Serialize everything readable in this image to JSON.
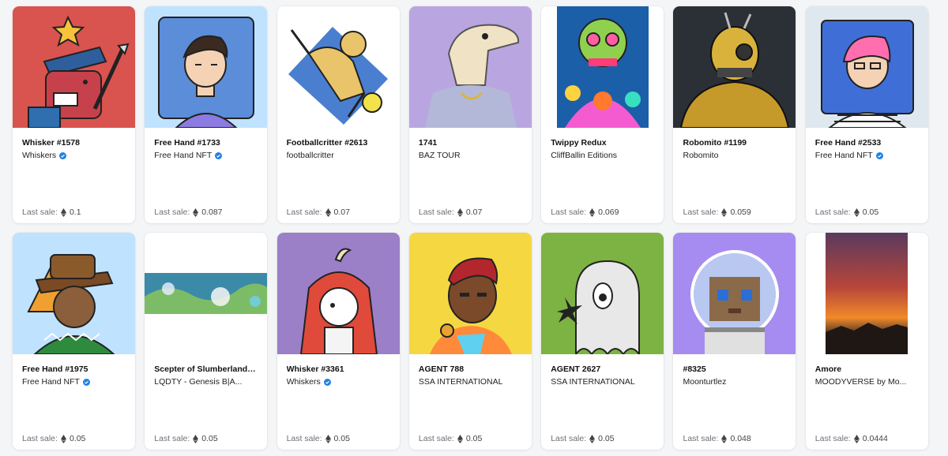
{
  "sale_label": "Last sale:",
  "cards": [
    {
      "title": "Whisker #1578",
      "collection": "Whiskers",
      "verified": true,
      "price": "0.1",
      "bg": "#d9534f"
    },
    {
      "title": "Free Hand #1733",
      "collection": "Free Hand NFT",
      "verified": true,
      "price": "0.087",
      "bg": "#bfe2ff"
    },
    {
      "title": "Footballcritter #2613",
      "collection": "footballcritter",
      "verified": false,
      "price": "0.07",
      "bg": "#ffffff"
    },
    {
      "title": "1741",
      "collection": "BAZ TOUR",
      "verified": false,
      "price": "0.07",
      "bg": "#b9a6e0"
    },
    {
      "title": "Twippy Redux",
      "collection": "CliffBallin Editions",
      "verified": false,
      "price": "0.069",
      "bg": "#ffffff"
    },
    {
      "title": "Robomito #1199",
      "collection": "Robomito",
      "verified": false,
      "price": "0.059",
      "bg": "#2b2f36"
    },
    {
      "title": "Free Hand #2533",
      "collection": "Free Hand NFT",
      "verified": true,
      "price": "0.05",
      "bg": "#dfe8ee"
    },
    {
      "title": "Free Hand #1975",
      "collection": "Free Hand NFT",
      "verified": true,
      "price": "0.05",
      "bg": "#bfe2ff"
    },
    {
      "title": "Scepter of Slumberland |...",
      "collection": "LQDTY - Genesis B|A...",
      "verified": false,
      "price": "0.05",
      "bg": "#ffffff"
    },
    {
      "title": "Whisker #3361",
      "collection": "Whiskers",
      "verified": true,
      "price": "0.05",
      "bg": "#9b7fc7"
    },
    {
      "title": "AGENT 788",
      "collection": "SSA INTERNATIONAL",
      "verified": false,
      "price": "0.05",
      "bg": "#f5d742"
    },
    {
      "title": "AGENT 2627",
      "collection": "SSA INTERNATIONAL",
      "verified": false,
      "price": "0.05",
      "bg": "#7cb342"
    },
    {
      "title": "#8325",
      "collection": "Moonturtlez",
      "verified": false,
      "price": "0.048",
      "bg": "#a68cf0"
    },
    {
      "title": "Amore",
      "collection": "MOODYVERSE by Mo...",
      "verified": false,
      "price": "0.0444",
      "bg": "#ffffff"
    }
  ]
}
